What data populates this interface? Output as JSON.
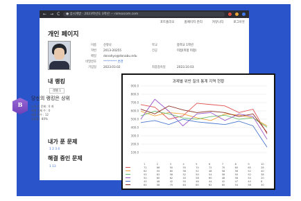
{
  "browser": {
    "address": "● 상시개방 · 2023학년도 3학년 ··· nimsocom.com",
    "nav_icons": [
      "←",
      "→",
      "C"
    ],
    "ext_colors": [
      "#e54b3c",
      "#e8a33a",
      "#3f7bea"
    ]
  },
  "topnav": [
    "포트폴리오",
    "홈페이지 관리",
    "커뮤니티",
    "로그아웃"
  ],
  "page_title": "개인 페이지",
  "profile": {
    "rows": [
      {
        "k": "이름",
        "v": "신유나",
        "k2": "학교",
        "v2": "중학교 1학년"
      },
      {
        "k": "학번",
        "v": "2013-20255",
        "k2": "전공",
        "v2": "미정(미정 미정)"
      },
      {
        "k": "메일",
        "v": "donahyo@donabu.edu",
        "k2": "",
        "v2": ""
      },
      {
        "k": "비밀번호",
        "v": "********* 변경",
        "k2": "",
        "v2": ""
      },
      {
        "k": "가입일",
        "v": "2023.03.02",
        "k2": "최종접속일",
        "v2": "2023.10.03"
      }
    ]
  },
  "ranking": {
    "title": "내 랭킹",
    "tab": "레벨 1",
    "badge_num": "B",
    "headline": "당신의 랭킹은 상위",
    "lines": [
      "누적 푼 문제 : 0 개",
      "해결 문제 수 : 0",
      "제출 횟수 : 12",
      "정답률 : 80%"
    ]
  },
  "my_problems": {
    "title": "내가 푼 문제",
    "links": "1 2 3 4"
  },
  "solving": {
    "title": "해결 중인 문제",
    "links": "1 13"
  },
  "chart_data": {
    "type": "line",
    "title": "과제별 위반 질의 통계 지역 현황",
    "ylabel": "",
    "ylim": [
      0,
      100
    ],
    "yticks": [
      "100.0",
      "200.0",
      "300.0",
      "400.0",
      "500.0",
      "600.0",
      "700.0",
      "800.0",
      "900.0"
    ],
    "categories": [
      "1",
      "2",
      "3",
      "4",
      "5",
      "6",
      "7",
      "8",
      "9",
      "10"
    ],
    "series": [
      {
        "color": "#e05252",
        "values": [
          72,
          68,
          50,
          55,
          74,
          72,
          70,
          60,
          65,
          28
        ]
      },
      {
        "color": "#f0a030",
        "values": [
          62,
          55,
          60,
          58,
          52,
          48,
          58,
          56,
          52,
          40
        ]
      },
      {
        "color": "#6cc070",
        "values": [
          55,
          62,
          58,
          52,
          50,
          54,
          56,
          50,
          52,
          38
        ]
      },
      {
        "color": "#9a55c8",
        "values": [
          50,
          80,
          62,
          40,
          58,
          60,
          48,
          58,
          54,
          20
        ]
      },
      {
        "color": "#4a78d0",
        "values": [
          45,
          48,
          42,
          50,
          46,
          44,
          42,
          47,
          40,
          8
        ]
      },
      {
        "color": "#8a3020",
        "values": [
          65,
          58,
          70,
          64,
          60,
          62,
          60,
          54,
          58,
          30
        ]
      }
    ]
  }
}
